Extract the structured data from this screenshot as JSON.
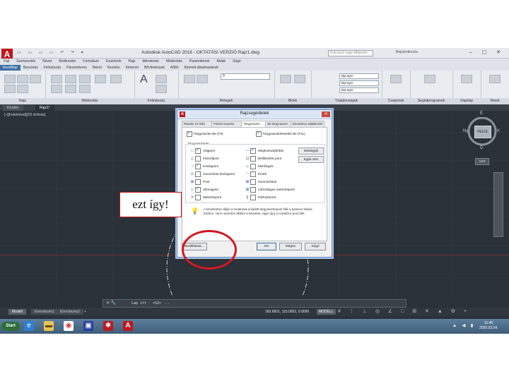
{
  "window": {
    "title": "Autodesk AutoCAD 2018 - OKTATÁSI VERZIÓ    Rajz1.dwg",
    "search_placeholder": "Kulcsszó vagy kifejezés",
    "signin_label": "Bejelentkezés",
    "window_controls": "– ▢ ✕",
    "qat_icons": "▭ ▭ ▭ ▭ ↶ ↷ ▾"
  },
  "menubar": {
    "items": [
      "Fájl",
      "Szerkesztés",
      "Nézet",
      "Beillesztés",
      "Formátum",
      "Eszközök",
      "Rajz",
      "Méretezés",
      "Módosítás",
      "Paraméterek",
      "Ablak",
      "Súgó"
    ]
  },
  "ribbon": {
    "tabs": [
      "Kezdőlap",
      "Beszúrás",
      "Feliratozás",
      "Paraméteres",
      "Nézet",
      "Kezelés",
      "Kimenet",
      "Bővítmények",
      "A360",
      "Kiemelt alkalmazások"
    ],
    "panels": [
      "Rajz",
      "Módosítás",
      "Feliratozás",
      "Rétegek",
      "Blokk",
      "Tulajdonságok",
      "Csoportok",
      "Segédprogramok",
      "Vágólap",
      "Nézet"
    ],
    "layer_value": "0",
    "bylayer_label": "ByLayer"
  },
  "file_tabs": [
    "Kezdés",
    "Rajz1*"
  ],
  "viewport_label": "[–][Felülnézet][2D drótváz]",
  "viewcube": {
    "face": "FELÜL",
    "north": "É",
    "south": "D",
    "west": "Ny",
    "east": "K",
    "wcs": "VKR"
  },
  "dialog": {
    "title": "Rajzsegédletek",
    "close_glyph": "✕",
    "tabs": [
      "Raszter és háló",
      "Poláris követés",
      "Tárgyraszter",
      "3D tárgyraszter",
      "Dinamikus adatbevitel"
    ],
    "active_tab": 2,
    "snap_on_label": "Tárgyraszter Be (F3)",
    "tracking_on_label": "Tárgyraszterkövetés Be (F11)",
    "modes_label": "Tárgyraszterek",
    "left_options": [
      {
        "sym": "□",
        "label": "Végpont",
        "checked": true
      },
      {
        "sym": "△",
        "label": "Felezőpont",
        "checked": false
      },
      {
        "sym": "○",
        "label": "Középpont",
        "checked": true
      },
      {
        "sym": "⊙",
        "label": "Geometriai középpont",
        "checked": false
      },
      {
        "sym": "⊠",
        "label": "Pont",
        "checked": false
      },
      {
        "sym": "◇",
        "label": "Síknegyed",
        "checked": true
      },
      {
        "sym": "✕",
        "label": "Metszéspont",
        "checked": false
      }
    ],
    "right_options": [
      {
        "sym": "—",
        "label": "Meghosszabbítás",
        "checked": true
      },
      {
        "sym": "⊡",
        "label": "Beillesztési pont",
        "checked": false
      },
      {
        "sym": "⊥",
        "label": "Merőleges",
        "checked": false
      },
      {
        "sym": "◠",
        "label": "Érintő",
        "checked": false
      },
      {
        "sym": "⊠",
        "label": "Szomszédos",
        "checked": false
      },
      {
        "sym": "⊠",
        "label": "Látszólagos metszéspont",
        "checked": false
      },
      {
        "sym": "∥",
        "label": "Párhuzamos",
        "checked": false
      }
    ],
    "select_all_label": "Mindegyik",
    "clear_all_label": "Egyik sem",
    "note": "A követéshez álljon a mutatóval a kijelölt tárgyraszterpont fölé a parancs futása közben. Ha le szeretné állítani a követést, vigye újra a mutatót a pont fölé.",
    "options_button": "Beállítások...",
    "ok_button": "OK",
    "cancel_button": "Mégse",
    "help_button": "Súgó"
  },
  "command_line": {
    "prompt": "Lap itt - <S2> ...",
    "close_glyph": "✕ 🔧"
  },
  "layout_tabs": [
    "Modell",
    "Elrendezés1",
    "Elrendezés2",
    "+"
  ],
  "status": {
    "coords": "183.6831, 115.0952, 0.0000",
    "model_label": "MODELL",
    "icons": "# ⋮ ⊥ ◎ ∠ □ ⊞ ✕ ▲ ⚙ +"
  },
  "taskbar": {
    "start_label": "Start",
    "time": "11:46",
    "date": "2020.03.24.",
    "tray_icons": "▲ ◀ ▮"
  },
  "annotation": {
    "text": "ezt így!"
  },
  "colors": {
    "accent": "#3b6ea5",
    "annotation_red": "#d31820",
    "autocad_red": "#c0161c",
    "drawing_bg": "#2b3138"
  }
}
